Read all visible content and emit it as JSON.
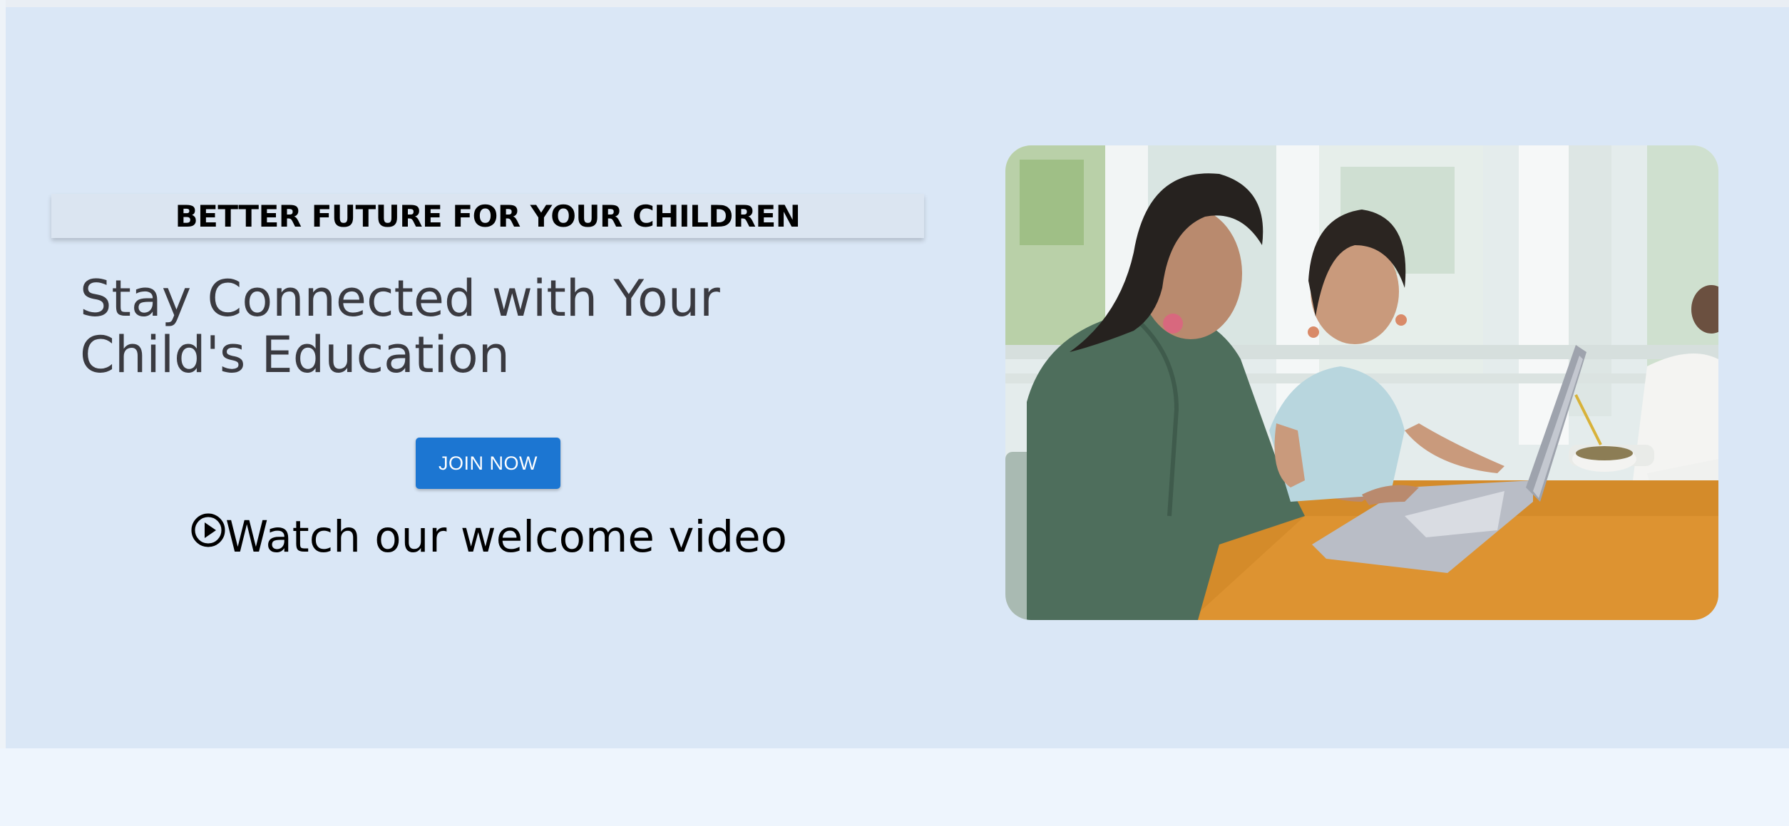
{
  "hero": {
    "tagline": "BETTER FUTURE FOR YOUR CHILDREN",
    "headline": "Stay Connected with Your Child's Education",
    "join_button": "JOIN NOW",
    "watch_video": "Watch our welcome video",
    "play_icon": "play-circle-icon",
    "image": "parent-and-child-using-laptop-photo"
  },
  "colors": {
    "hero_background": "#dae7f6",
    "page_background": "#eef5fd",
    "button": "#1c76d2",
    "headline_text": "#3a3a40"
  }
}
